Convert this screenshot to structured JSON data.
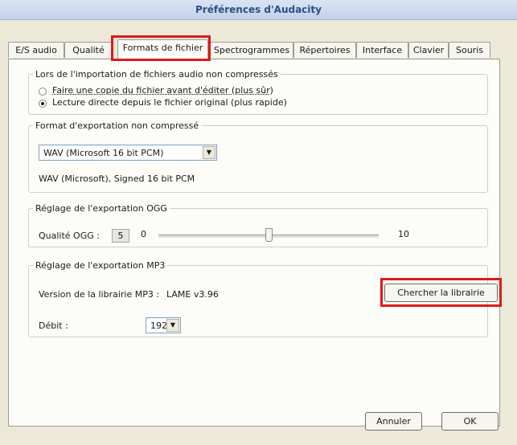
{
  "window": {
    "title": "Préférences d'Audacity"
  },
  "tabs": [
    {
      "label": "E/S audio"
    },
    {
      "label": "Qualité"
    },
    {
      "label": "Formats de fichier"
    },
    {
      "label": "Spectrogrammes"
    },
    {
      "label": "Répertoires"
    },
    {
      "label": "Interface"
    },
    {
      "label": "Clavier"
    },
    {
      "label": "Souris"
    }
  ],
  "active_tab": "Formats de fichier",
  "import_group": {
    "legend": "Lors de l'importation de fichiers audio non compressés",
    "options": [
      {
        "label": "Faire une copie du fichier avant d'éditer (plus sûr)",
        "checked": false
      },
      {
        "label": "Lecture directe depuis le fichier original (plus rapide)",
        "checked": true
      }
    ]
  },
  "export_group": {
    "legend": "Format d'exportation non compressé",
    "format_value": "WAV (Microsoft 16 bit PCM)",
    "format_description": "WAV (Microsoft), Signed 16 bit PCM"
  },
  "ogg_group": {
    "legend": "Réglage de l'exportation OGG",
    "quality_label": "Qualité OGG :",
    "quality_value": "5",
    "min_label": "0",
    "max_label": "10",
    "slider_level": 0.5
  },
  "mp3_group": {
    "legend": "Réglage de l'exportation MP3",
    "version_label": "Version de la librairie MP3 :",
    "version_value": "LAME v3.96",
    "find_library_button": "Chercher la librairie",
    "bitrate_label": "Débit :",
    "bitrate_value": "192"
  },
  "footer": {
    "cancel_button": "Annuler",
    "ok_button": "OK"
  },
  "highlight_color": "#e01919"
}
